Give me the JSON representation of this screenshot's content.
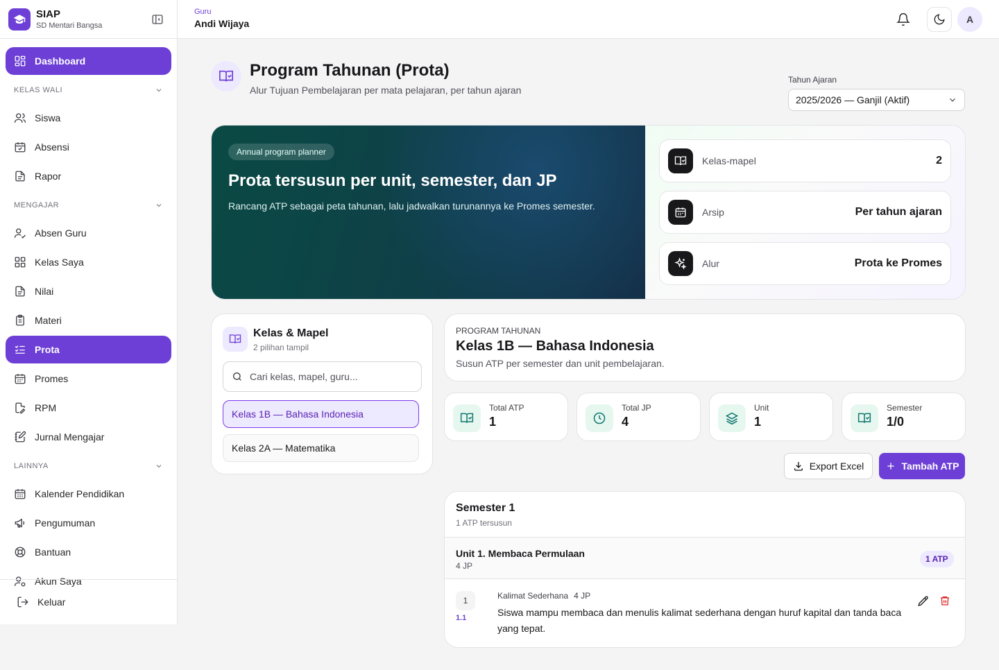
{
  "brand": {
    "name": "SIAP",
    "school": "SD Mentari Bangsa"
  },
  "nav": {
    "dashboard": "Dashboard",
    "kelas_wali": "KELAS WALI",
    "siswa": "Siswa",
    "absensi": "Absensi",
    "rapor": "Rapor",
    "mengajar": "MENGAJAR",
    "absen_guru": "Absen Guru",
    "kelas_saya": "Kelas Saya",
    "nilai": "Nilai",
    "materi": "Materi",
    "prota": "Prota",
    "promes": "Promes",
    "rpm": "RPM",
    "jurnal": "Jurnal Mengajar",
    "lainnya": "LAINNYA",
    "kalender": "Kalender Pendidikan",
    "pengumuman": "Pengumuman",
    "bantuan": "Bantuan",
    "akun": "Akun Saya",
    "keluar": "Keluar"
  },
  "user": {
    "role": "Guru",
    "name": "Andi Wijaya",
    "initial": "A"
  },
  "page": {
    "title": "Program Tahunan (Prota)",
    "subtitle": "Alur Tujuan Pembelajaran per mata pelajaran, per tahun ajaran"
  },
  "tahun_ajaran": {
    "label": "Tahun Ajaran",
    "value": "2025/2026 — Ganjil (Aktif)"
  },
  "hero": {
    "badge": "Annual program planner",
    "title": "Prota tersusun per unit, semester, dan JP",
    "text": "Rancang ATP sebagai peta tahunan, lalu jadwalkan turunannya ke Promes semester.",
    "stats": [
      {
        "label": "Kelas-mapel",
        "value": "2"
      },
      {
        "label": "Arsip",
        "value": "Per tahun ajaran"
      },
      {
        "label": "Alur",
        "value": "Prota ke Promes"
      }
    ]
  },
  "kelas_mapel": {
    "title": "Kelas & Mapel",
    "subtitle": "2 pilihan tampil",
    "search_placeholder": "Cari kelas, mapel, guru...",
    "items": [
      "Kelas 1B — Bahasa Indonesia",
      "Kelas 2A — Matematika"
    ]
  },
  "prota": {
    "overline": "PROGRAM TAHUNAN",
    "title": "Kelas 1B — Bahasa Indonesia",
    "subtitle": "Susun ATP per semester dan unit pembelajaran.",
    "stats": [
      {
        "label": "Total ATP",
        "value": "1"
      },
      {
        "label": "Total JP",
        "value": "4"
      },
      {
        "label": "Unit",
        "value": "1"
      },
      {
        "label": "Semester",
        "value": "1/0"
      }
    ],
    "export_label": "Export Excel",
    "add_label": "Tambah ATP"
  },
  "semester": {
    "title": "Semester 1",
    "subtitle": "1 ATP tersusun",
    "unit": {
      "title": "Unit 1. Membaca Permulaan",
      "jp": "4 JP",
      "badge": "1 ATP"
    },
    "atp": {
      "number": "1",
      "code": "1.1",
      "topic": "Kalimat Sederhana",
      "jp": "4 JP",
      "description": "Siswa mampu membaca dan menulis kalimat sederhana dengan huruf kapital dan tanda baca yang tepat."
    }
  },
  "colors": {
    "primary": "#6d3fd6",
    "hero_dark": "#0a4a44",
    "danger": "#dc2626",
    "teal": "#0f766e"
  }
}
